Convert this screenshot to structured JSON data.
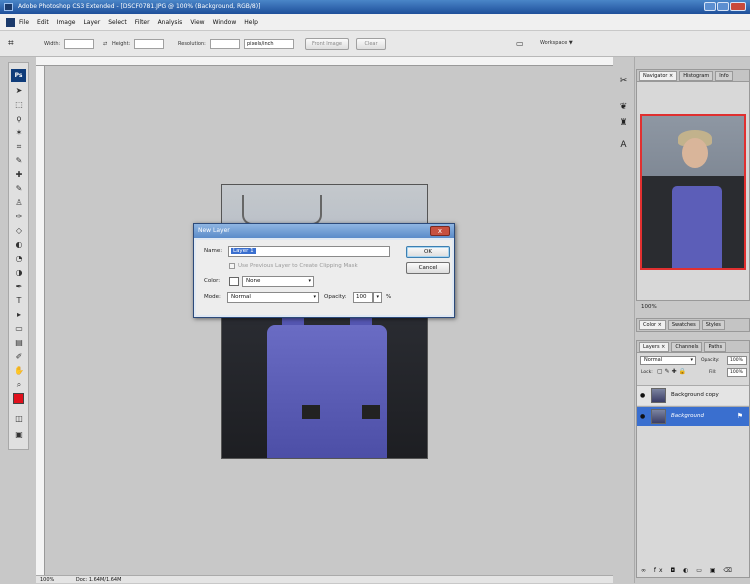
{
  "window": {
    "title": "Adobe Photoshop CS3 Extended - [DSCF0781.JPG @ 100% (Background, RGB/8)]"
  },
  "menu": [
    "File",
    "Edit",
    "Image",
    "Layer",
    "Select",
    "Filter",
    "Analysis",
    "View",
    "Window",
    "Help"
  ],
  "options": {
    "width_label": "Width:",
    "height_label": "Height:",
    "resolution_label": "Resolution:",
    "resolution_unit": "pixels/inch",
    "front_image": "Front Image",
    "clear": "Clear",
    "workspace": "Workspace ▼"
  },
  "dialog": {
    "title": "New Layer",
    "name_label": "Name:",
    "name_value": "Layer 1",
    "clip_label": "Use Previous Layer to Create Clipping Mask",
    "color_label": "Color:",
    "color_value": "None",
    "mode_label": "Mode:",
    "mode_value": "Normal",
    "opacity_label": "Opacity:",
    "opacity_value": "100",
    "opacity_unit": "%",
    "ok": "OK",
    "cancel": "Cancel",
    "close_glyph": "x"
  },
  "panels": {
    "navigator_tabs": [
      "Navigator ×",
      "Histogram",
      "Info"
    ],
    "zoom": "100%",
    "color_tabs": [
      "Color ×",
      "Swatches",
      "Styles"
    ],
    "layers_tabs": [
      "Layers ×",
      "Channels",
      "Paths"
    ],
    "blend": "Normal",
    "opacity_label": "Opacity:",
    "opacity_value": "100%",
    "lock_label": "Lock:",
    "fill_label": "Fill:",
    "fill_value": "100%",
    "layers": [
      {
        "name": "Background copy"
      },
      {
        "name": "Background"
      }
    ]
  },
  "status": {
    "zoom": "100%",
    "doc": "Doc: 1.64M/1.64M"
  },
  "colors": {
    "foreground": "#e0101c",
    "selection": "#3a6fcf"
  }
}
